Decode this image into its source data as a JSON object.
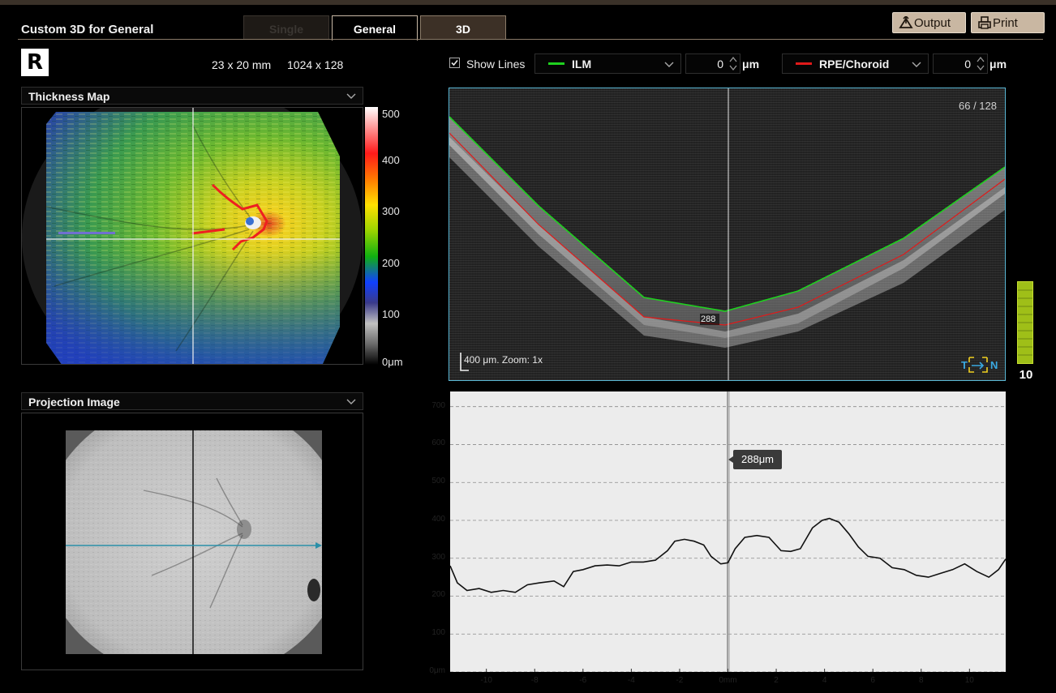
{
  "app": {
    "title": "Custom 3D for General"
  },
  "tabs": {
    "single": "Single",
    "general": "General",
    "three_d": "3D"
  },
  "header_buttons": {
    "output": "Output",
    "print": "Print"
  },
  "scan": {
    "eye": "R",
    "dimensions": "23 x 20 mm",
    "resolution": "1024 x 128"
  },
  "thickness_map": {
    "title": "Thickness Map",
    "colorbar_labels": [
      "500",
      "400",
      "300",
      "200",
      "100",
      "0μm"
    ]
  },
  "projection": {
    "title": "Projection Image"
  },
  "lines": {
    "show_lines_label": "Show Lines",
    "show_lines_checked": true,
    "upper": {
      "name": "ILM",
      "color": "#1fd11f",
      "offset": "0",
      "unit": "μm"
    },
    "lower": {
      "name": "RPE/Choroid",
      "color": "#e01a1a",
      "offset": "0",
      "unit": "μm"
    }
  },
  "bscan": {
    "slice": "66 / 128",
    "scale_text": "400 μm. Zoom: 1x",
    "marker_value": "288",
    "orientation": {
      "left": "T",
      "right": "N"
    }
  },
  "quality": {
    "value": "10",
    "level": 1.0,
    "color": "#9fbf18"
  },
  "profile_tooltip": "288μm",
  "chart_data": {
    "type": "line",
    "x_ticks": [
      "-10",
      "-8",
      "-6",
      "-4",
      "-2",
      "0mm",
      "2",
      "4",
      "6",
      "8",
      "10"
    ],
    "y_ticks": [
      "0μm",
      "100",
      "200",
      "300",
      "400",
      "500",
      "600",
      "700"
    ],
    "xlim": [
      -11.5,
      11.5
    ],
    "ylim": [
      0,
      740
    ],
    "cursor_x": 0,
    "grid": "horizontal dashed",
    "series": [
      {
        "values": [
          [
            -11.5,
            280
          ],
          [
            -11.2,
            235
          ],
          [
            -10.8,
            215
          ],
          [
            -10.3,
            220
          ],
          [
            -9.8,
            210
          ],
          [
            -9.3,
            215
          ],
          [
            -8.8,
            210
          ],
          [
            -8.3,
            230
          ],
          [
            -7.8,
            235
          ],
          [
            -7.2,
            240
          ],
          [
            -6.8,
            225
          ],
          [
            -6.4,
            265
          ],
          [
            -6.0,
            270
          ],
          [
            -5.5,
            280
          ],
          [
            -5.0,
            282
          ],
          [
            -4.5,
            280
          ],
          [
            -4.0,
            290
          ],
          [
            -3.5,
            290
          ],
          [
            -3.0,
            295
          ],
          [
            -2.5,
            320
          ],
          [
            -2.2,
            345
          ],
          [
            -1.8,
            350
          ],
          [
            -1.4,
            345
          ],
          [
            -1.0,
            335
          ],
          [
            -0.7,
            305
          ],
          [
            -0.3,
            285
          ],
          [
            0.0,
            288
          ],
          [
            0.3,
            325
          ],
          [
            0.7,
            355
          ],
          [
            1.2,
            360
          ],
          [
            1.7,
            355
          ],
          [
            2.2,
            320
          ],
          [
            2.6,
            318
          ],
          [
            3.0,
            325
          ],
          [
            3.5,
            380
          ],
          [
            3.9,
            400
          ],
          [
            4.2,
            405
          ],
          [
            4.6,
            395
          ],
          [
            5.0,
            365
          ],
          [
            5.4,
            330
          ],
          [
            5.8,
            305
          ],
          [
            6.3,
            300
          ],
          [
            6.8,
            275
          ],
          [
            7.3,
            270
          ],
          [
            7.8,
            255
          ],
          [
            8.3,
            250
          ],
          [
            8.8,
            260
          ],
          [
            9.3,
            270
          ],
          [
            9.8,
            285
          ],
          [
            10.3,
            265
          ],
          [
            10.8,
            250
          ],
          [
            11.2,
            270
          ],
          [
            11.5,
            298
          ]
        ]
      }
    ]
  }
}
